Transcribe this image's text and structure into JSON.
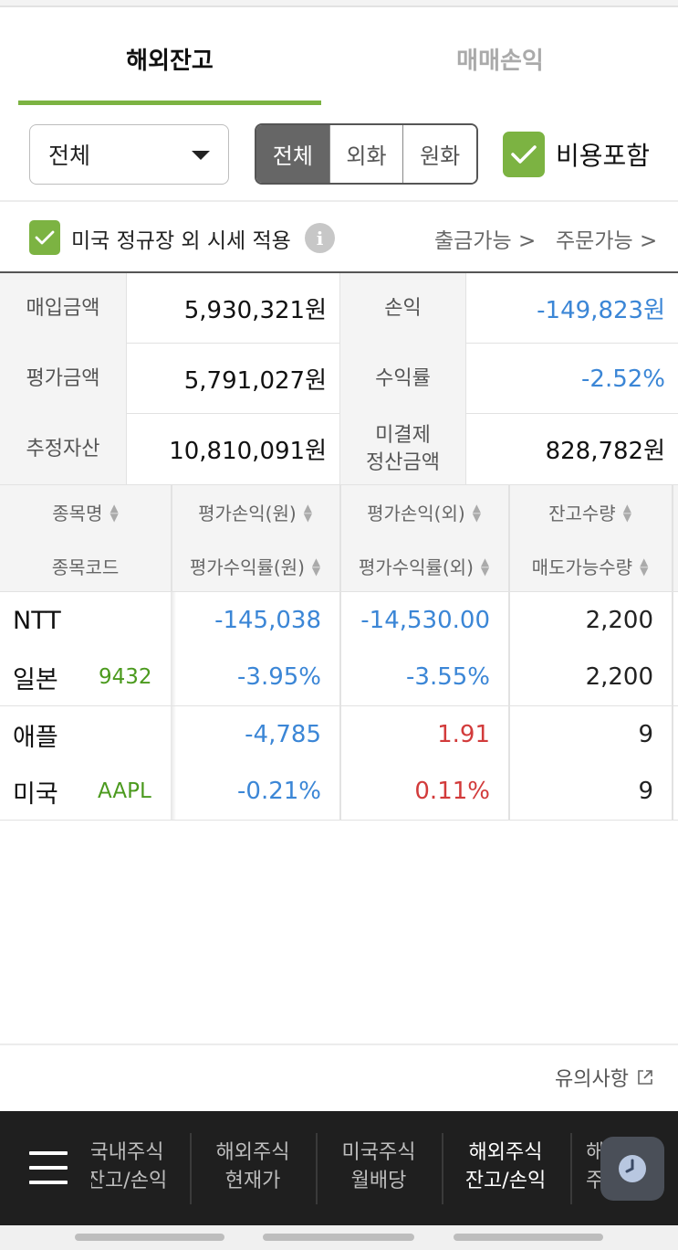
{
  "tabs": [
    {
      "label": "해외잔고"
    },
    {
      "label": "매매손익"
    }
  ],
  "filter": {
    "dropdown_value": "전체",
    "segment": [
      "전체",
      "외화",
      "원화"
    ],
    "selected_segment": "전체",
    "cost_include_label": "비용포함",
    "cost_include_checked": true
  },
  "options": {
    "us_regular_label": "미국 정규장 외 시세 적용",
    "us_regular_checked": true,
    "withdrawable_label": "출금가능 >",
    "orderable_label": "주문가능 >"
  },
  "summary": {
    "purchase_label": "매입금액",
    "purchase_value": "5,930,321원",
    "pl_label": "손익",
    "pl_value": "-149,823원",
    "eval_label": "평가금액",
    "eval_value": "5,791,027원",
    "return_label": "수익률",
    "return_value": "-2.52%",
    "assets_label": "추정자산",
    "assets_value": "10,810,091원",
    "unsettled_label_1": "미결제",
    "unsettled_label_2": "정산금액",
    "unsettled_value": "828,782원"
  },
  "table": {
    "headers_row1": [
      "종목명",
      "평가손익(원)",
      "평가손익(외)",
      "잔고수량"
    ],
    "headers_row2": [
      "종목코드",
      "평가수익률(원)",
      "평가수익률(외)",
      "매도가능수량"
    ],
    "rows": [
      {
        "name": "NTT",
        "country": "일본",
        "code": "9432",
        "pl_krw": "-145,038",
        "pl_fx": "-14,530.00",
        "qty": "2,200",
        "rate_krw": "-3.95%",
        "rate_fx": "-3.55%",
        "sellable": "2,200"
      },
      {
        "name": "애플",
        "country": "미국",
        "code": "AAPL",
        "pl_krw": "-4,785",
        "pl_fx": "1.91",
        "qty": "9",
        "rate_krw": "-0.21%",
        "rate_fx": "0.11%",
        "sellable": "9"
      }
    ]
  },
  "notice_label": "유의사항",
  "bottom_nav": [
    {
      "line1": "국내주식",
      "line2": "잔고/손익"
    },
    {
      "line1": "해외주식",
      "line2": "현재가"
    },
    {
      "line1": "미국주식",
      "line2": "월배당"
    },
    {
      "line1": "해외주식",
      "line2": "잔고/손익"
    },
    {
      "line1": "해외",
      "line2": "주식"
    }
  ],
  "colors": {
    "accent_green": "#7cb342",
    "negative_blue": "#3b86d6",
    "positive_red": "#d23b3b",
    "code_green": "#4b9a1e"
  },
  "icons": [
    "dropdown-caret-icon",
    "checkmark-icon",
    "info-icon",
    "chevron-right-icon",
    "sort-icon",
    "external-link-icon",
    "hamburger-menu-icon",
    "clock-icon"
  ]
}
